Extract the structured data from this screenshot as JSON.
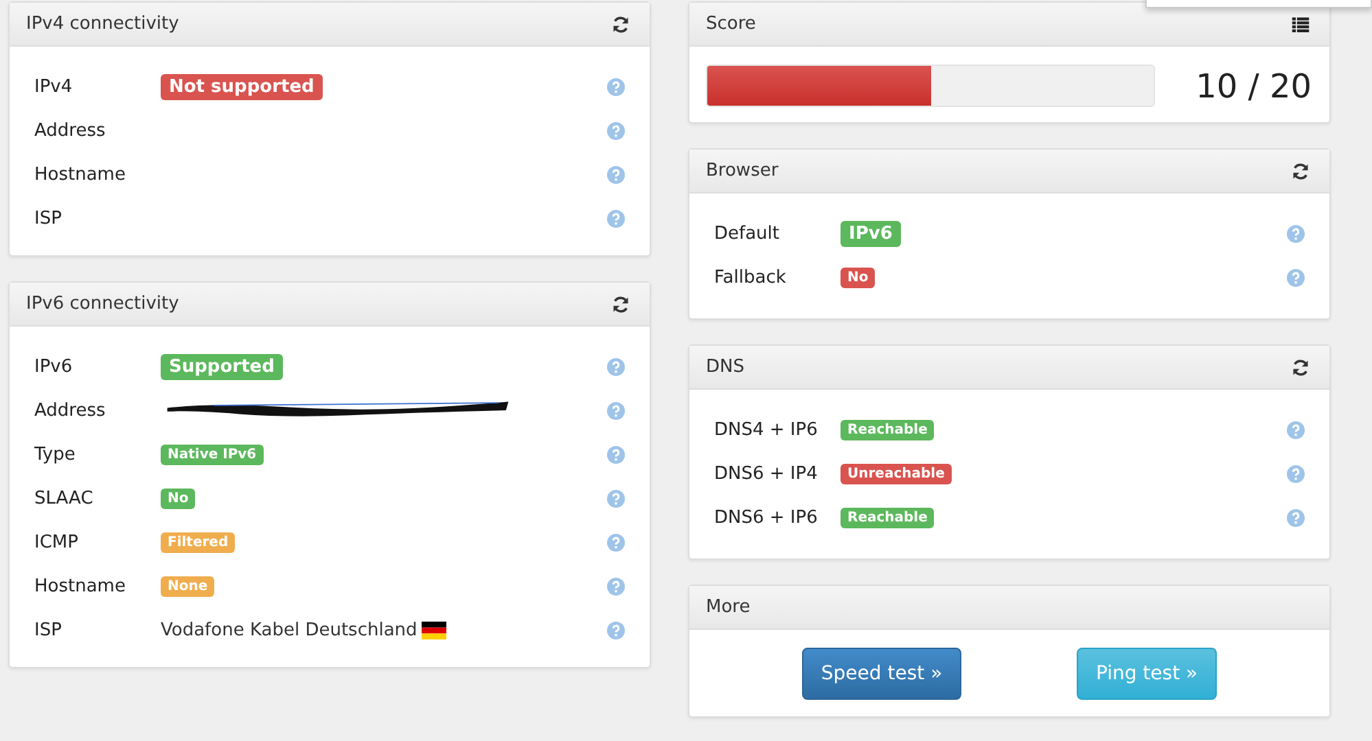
{
  "left_panels": [
    {
      "title": "IPv4 connectivity",
      "rows": [
        {
          "label": "IPv4",
          "kind": "badge",
          "value": "Not supported",
          "color": "#d9534f"
        },
        {
          "label": "Address",
          "kind": "empty"
        },
        {
          "label": "Hostname",
          "kind": "empty"
        },
        {
          "label": "ISP",
          "kind": "empty"
        }
      ]
    },
    {
      "title": "IPv6 connectivity",
      "rows": [
        {
          "label": "IPv6",
          "kind": "badge",
          "value": "Supported",
          "color": "#5cb85c"
        },
        {
          "label": "Address",
          "kind": "redacted"
        },
        {
          "label": "Type",
          "kind": "label",
          "value": "Native IPv6",
          "color": "#5cb85c"
        },
        {
          "label": "SLAAC",
          "kind": "label",
          "value": "No",
          "color": "#5cb85c"
        },
        {
          "label": "ICMP",
          "kind": "label",
          "value": "Filtered",
          "color": "#f0ad4e"
        },
        {
          "label": "Hostname",
          "kind": "label",
          "value": "None",
          "color": "#f0ad4e"
        },
        {
          "label": "ISP",
          "kind": "text",
          "value": "Vodafone Kabel Deutschland",
          "flag": true
        }
      ]
    }
  ],
  "score": {
    "title": "Score",
    "level": 0.5,
    "reading": "10 / 20"
  },
  "right_panels": [
    {
      "title": "Browser",
      "rows": [
        {
          "label": "Default",
          "kind": "badge",
          "value": "IPv6",
          "color": "#5cb85c"
        },
        {
          "label": "Fallback",
          "kind": "label",
          "value": "No",
          "color": "#d9534f"
        }
      ]
    },
    {
      "title": "DNS",
      "rows": [
        {
          "label": "DNS4 + IP6",
          "kind": "label",
          "value": "Reachable",
          "color": "#5cb85c"
        },
        {
          "label": "DNS6 + IP4",
          "kind": "label",
          "value": "Unreachable",
          "color": "#d9534f"
        },
        {
          "label": "DNS6 + IP6",
          "kind": "label",
          "value": "Reachable",
          "color": "#5cb85c"
        }
      ]
    }
  ],
  "more": {
    "title": "More",
    "buttons": [
      {
        "label": "Speed test »",
        "kind": "primary"
      },
      {
        "label": "Ping test »",
        "kind": "info"
      }
    ]
  }
}
